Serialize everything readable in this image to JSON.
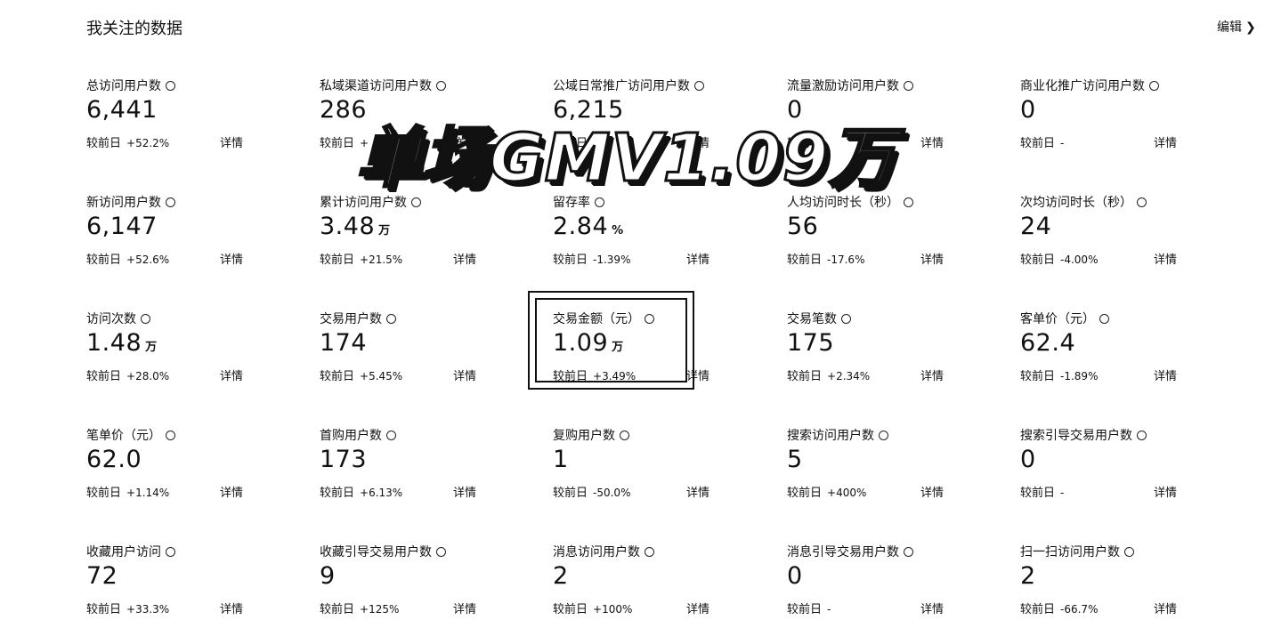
{
  "header": {
    "title": "我关注的数据",
    "edit_label": "编辑",
    "edit_icon": "chevron-right-icon"
  },
  "overlay": {
    "text": "单场GMV1.09万"
  },
  "compare_label": "较前日",
  "detail_label": "详情",
  "metrics": [
    {
      "label": "总访问用户数",
      "value": "6,441",
      "unit": "",
      "change": "+52.2%"
    },
    {
      "label": "私域渠道访问用户数",
      "value": "286",
      "unit": "",
      "change": "+"
    },
    {
      "label": "公域日常推广访问用户数",
      "value": "6,215",
      "unit": "",
      "change": ""
    },
    {
      "label": "流量激励访问用户数",
      "value": "0",
      "unit": "",
      "change": ""
    },
    {
      "label": "商业化推广访问用户数",
      "value": "0",
      "unit": "",
      "change": "-"
    },
    {
      "label": "新访问用户数",
      "value": "6,147",
      "unit": "",
      "change": "+52.6%"
    },
    {
      "label": "累计访问用户数",
      "value": "3.48",
      "unit": "万",
      "change": "+21.5%"
    },
    {
      "label": "留存率",
      "value": "2.84",
      "unit": "%",
      "change": "-1.39%"
    },
    {
      "label": "人均访问时长（秒）",
      "value": "56",
      "unit": "",
      "change": "-17.6%"
    },
    {
      "label": "次均访问时长（秒）",
      "value": "24",
      "unit": "",
      "change": "-4.00%"
    },
    {
      "label": "访问次数",
      "value": "1.48",
      "unit": "万",
      "change": "+28.0%"
    },
    {
      "label": "交易用户数",
      "value": "174",
      "unit": "",
      "change": "+5.45%"
    },
    {
      "label": "交易金额（元）",
      "value": "1.09",
      "unit": "万",
      "change": "+3.49%"
    },
    {
      "label": "交易笔数",
      "value": "175",
      "unit": "",
      "change": "+2.34%"
    },
    {
      "label": "客单价（元）",
      "value": "62.4",
      "unit": "",
      "change": "-1.89%"
    },
    {
      "label": "笔单价（元）",
      "value": "62.0",
      "unit": "",
      "change": "+1.14%"
    },
    {
      "label": "首购用户数",
      "value": "173",
      "unit": "",
      "change": "+6.13%"
    },
    {
      "label": "复购用户数",
      "value": "1",
      "unit": "",
      "change": "-50.0%"
    },
    {
      "label": "搜索访问用户数",
      "value": "5",
      "unit": "",
      "change": "+400%"
    },
    {
      "label": "搜索引导交易用户数",
      "value": "0",
      "unit": "",
      "change": "-"
    },
    {
      "label": "收藏用户访问",
      "value": "72",
      "unit": "",
      "change": "+33.3%"
    },
    {
      "label": "收藏引导交易用户数",
      "value": "9",
      "unit": "",
      "change": "+125%"
    },
    {
      "label": "消息访问用户数",
      "value": "2",
      "unit": "",
      "change": "+100%"
    },
    {
      "label": "消息引导交易用户数",
      "value": "0",
      "unit": "",
      "change": "-"
    },
    {
      "label": "扫一扫访问用户数",
      "value": "2",
      "unit": "",
      "change": "-66.7%"
    }
  ]
}
